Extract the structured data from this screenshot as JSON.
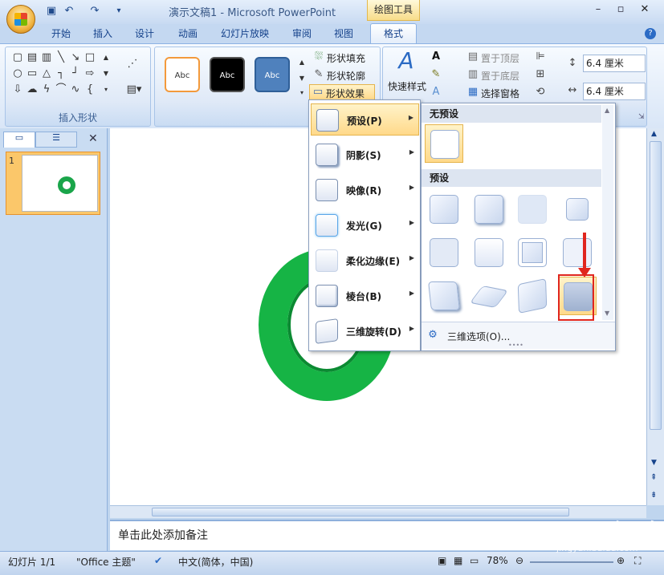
{
  "window": {
    "title": "演示文稿1 - Microsoft PowerPoint",
    "context_tool": "绘图工具"
  },
  "tabs": [
    "开始",
    "插入",
    "设计",
    "动画",
    "幻灯片放映",
    "审阅",
    "视图",
    "格式"
  ],
  "ribbon": {
    "groups": {
      "insert_shapes": "插入形状",
      "shape_styles": "形状样式"
    },
    "style_thumbs": [
      "Abc",
      "Abc",
      "Abc"
    ],
    "fill_label": "形状填充",
    "outline_label": "形状轮廓",
    "effects_label": "形状效果",
    "quick_styles_label": "快速样式",
    "bring_front": "置于顶层",
    "send_back": "置于底层",
    "selection_pane": "选择窗格",
    "height_value": "6.4 厘米",
    "width_value": "6.4 厘米"
  },
  "effects_menu": {
    "items": [
      {
        "label": "预设(P)"
      },
      {
        "label": "阴影(S)"
      },
      {
        "label": "映像(R)"
      },
      {
        "label": "发光(G)"
      },
      {
        "label": "柔化边缘(E)"
      },
      {
        "label": "棱台(B)"
      },
      {
        "label": "三维旋转(D)"
      }
    ]
  },
  "preset_submenu": {
    "no_preset_header": "无预设",
    "preset_header": "预设",
    "options_label": "三维选项(O)..."
  },
  "slides_panel": {
    "slide_number": "1"
  },
  "notes_placeholder": "单击此处添加备注",
  "status": {
    "slide": "幻灯片 1/1",
    "theme": "\"Office 主题\"",
    "language": "中文(简体，中国)",
    "zoom": "78%"
  },
  "watermark": {
    "brand": "Baidu 经验",
    "url": "jingyan.baidu.com"
  },
  "colors": {
    "ring": "#16b445",
    "highlight": "#ffd98a",
    "annotation": "#e0261e"
  }
}
